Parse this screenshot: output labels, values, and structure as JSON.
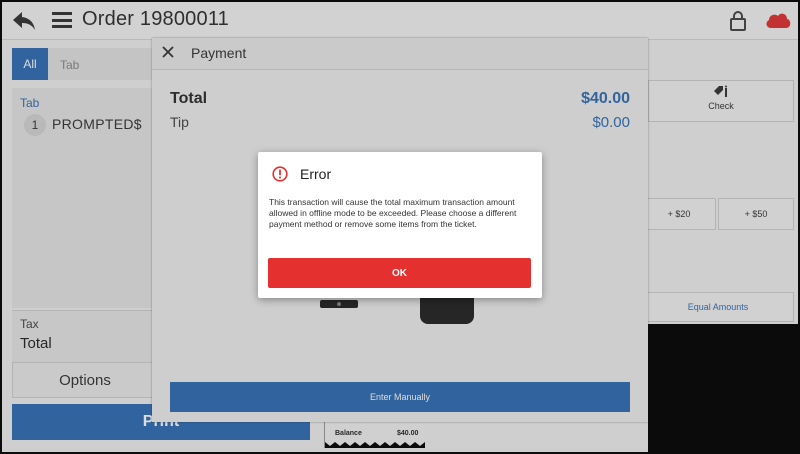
{
  "header": {
    "title": "Order 19800011",
    "icons": {
      "back": "back-arrow-icon",
      "menu": "hamburger-menu-icon",
      "lock": "lock-icon",
      "cloud": "cloud-offline-icon"
    },
    "cloud_color": "#e03030"
  },
  "ticket": {
    "tabs": [
      "All",
      "Tab"
    ],
    "group_label": "Tab",
    "items": [
      {
        "qty": "1",
        "name": "PROMPTED$"
      }
    ],
    "tax_label": "Tax",
    "total_label": "Total",
    "options_label": "Options",
    "print_label": "Print"
  },
  "side_panel": {
    "check_label": "Check",
    "cash_buttons": [
      "+ $20",
      "+ $50"
    ],
    "equal_amounts_label": "Equal Amounts",
    "receipt": {
      "balance_label": "Balance",
      "balance_value": "$40.00"
    }
  },
  "payment": {
    "title": "Payment",
    "total_label": "Total",
    "total_value": "$40.00",
    "tip_label": "Tip",
    "tip_value": "$0.00",
    "enter_manually_label": "Enter Manually"
  },
  "dialog": {
    "title": "Error",
    "message": "This transaction will cause the total maximum transaction amount allowed in offline mode to be exceeded. Please choose a different payment method or remove some items from the ticket.",
    "ok_label": "OK",
    "accent": "#e53030"
  },
  "colors": {
    "primary": "#2f6db5",
    "error": "#e53030"
  }
}
